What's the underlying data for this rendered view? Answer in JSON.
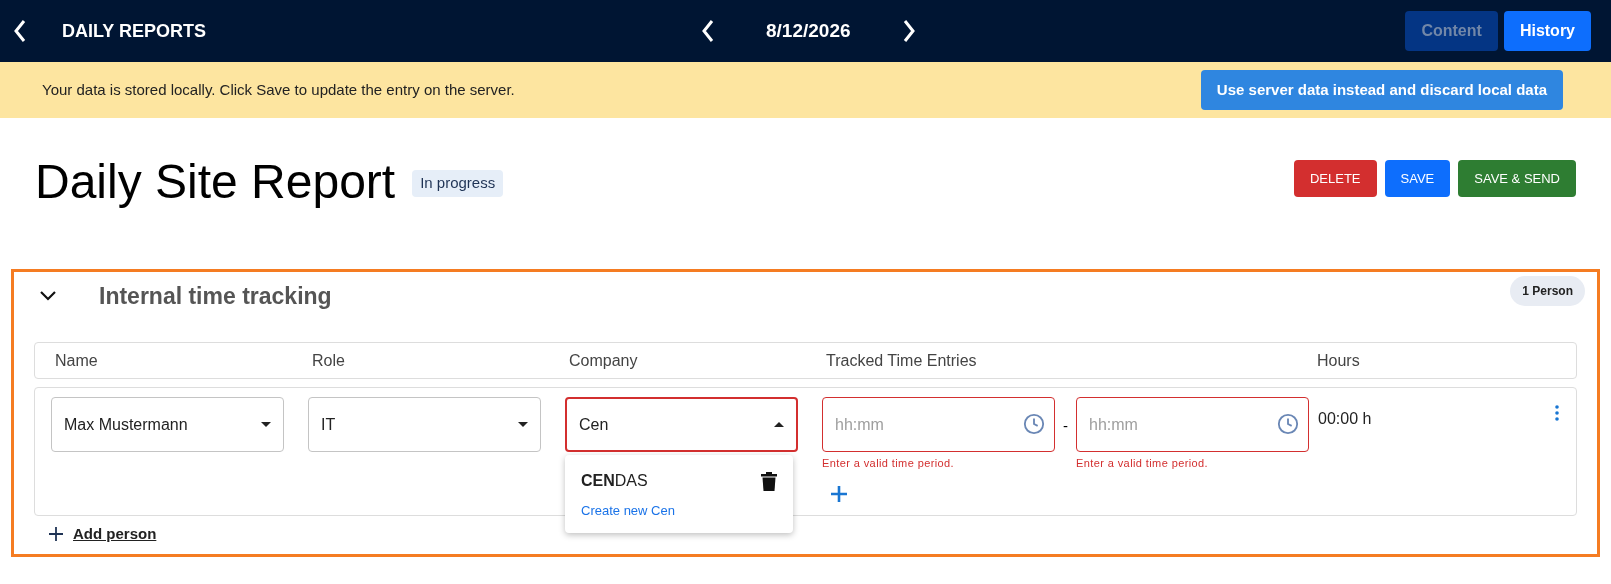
{
  "topbar": {
    "title": "DAILY REPORTS",
    "date": "8/12/2026",
    "buttons": [
      {
        "label": "Content",
        "disabled": true
      },
      {
        "label": "History",
        "disabled": false
      }
    ]
  },
  "banner": {
    "message": "Your data is stored locally. Click Save to update the entry on the server.",
    "button": "Use server data instead and discard local data"
  },
  "page": {
    "title": "Daily Site Report",
    "status": "In progress",
    "actions": [
      {
        "label": "DELETE",
        "kind": "danger"
      },
      {
        "label": "SAVE",
        "kind": "primary"
      },
      {
        "label": "SAVE & SEND",
        "kind": "success"
      }
    ]
  },
  "section": {
    "title": "Internal time tracking",
    "expanded": true,
    "count": "1 Person",
    "columns": [
      "Name",
      "Role",
      "Company",
      "Tracked Time Entries",
      "Hours"
    ],
    "rows": [
      {
        "name": "Max Mustermann",
        "role": "IT",
        "company": {
          "value": "Cen",
          "error": true,
          "open": true,
          "options": [
            {
              "label": "**CEN**DAS"
            }
          ],
          "create": "Create new Cen"
        },
        "times": [
          {
            "placeholder": "hh:mm",
            "error": "Enter a valid time period."
          },
          {
            "placeholder": "hh:mm",
            "error": "Enter a valid time period."
          }
        ],
        "separator": "-",
        "hours": "00:00 h"
      }
    ],
    "add_label": "Add person"
  }
}
